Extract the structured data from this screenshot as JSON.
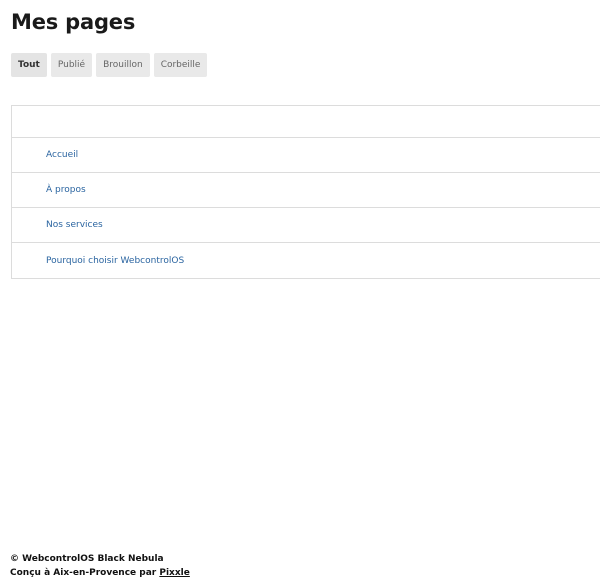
{
  "page": {
    "title": "Mes pages"
  },
  "filters": {
    "tabs": [
      {
        "label": "Tout",
        "active": true
      },
      {
        "label": "Publié",
        "active": false
      },
      {
        "label": "Brouillon",
        "active": false
      },
      {
        "label": "Corbeille",
        "active": false
      }
    ]
  },
  "pages_table": {
    "rows": [
      {
        "title": "Accueil"
      },
      {
        "title": "À propos"
      },
      {
        "title": "Nos services"
      },
      {
        "title": "Pourquoi choisir WebcontrolOS"
      }
    ]
  },
  "footer": {
    "copyright": "© WebcontrolOS Black Nebula",
    "credit_prefix": "Conçu à Aix-en-Provence par ",
    "credit_link": "Pixxle"
  },
  "colors": {
    "link": "#2a64a0",
    "tab_background": "#e9e9e9",
    "border": "#dcdcdc"
  }
}
